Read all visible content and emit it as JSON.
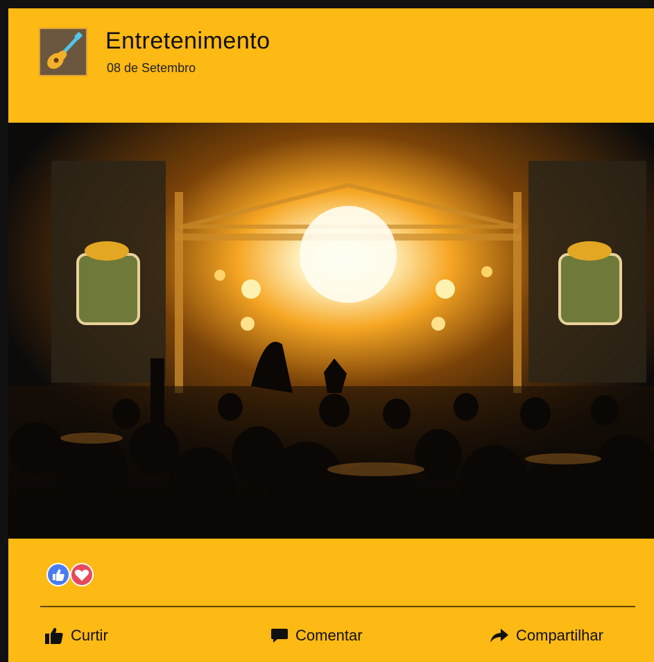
{
  "post": {
    "page_name": "Entretenimento",
    "date": "08 de Setembro",
    "photo_description": "concert-stage-crowd-image",
    "reactions": [
      "like-reaction-icon",
      "love-reaction-icon"
    ],
    "actions": {
      "like": "Curtir",
      "comment": "Comentar",
      "share": "Compartilhar"
    }
  },
  "colors": {
    "background": "#fdb914",
    "frame": "#111111",
    "like_blue": "#4a7cf0",
    "love_red": "#e9495d"
  }
}
